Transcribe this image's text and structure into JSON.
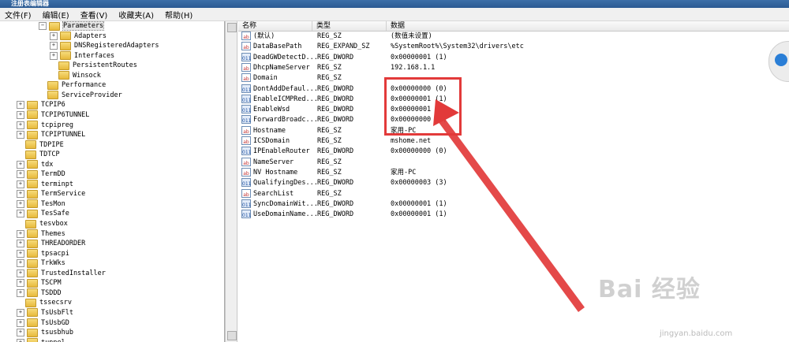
{
  "title_bar": {
    "title": "注册表编辑器"
  },
  "menu": [
    "文件(F)",
    "编辑(E)",
    "查看(V)",
    "收藏夹(A)",
    "帮助(H)"
  ],
  "tree": [
    {
      "label": "Parameters",
      "indent": 4,
      "expander": "minus",
      "selected": true
    },
    {
      "label": "Adapters",
      "indent": 5,
      "expander": "plus"
    },
    {
      "label": "DNSRegisteredAdapters",
      "indent": 5,
      "expander": "plus"
    },
    {
      "label": "Interfaces",
      "indent": 5,
      "expander": "plus"
    },
    {
      "label": "PersistentRoutes",
      "indent": 5,
      "expander": "none"
    },
    {
      "label": "Winsock",
      "indent": 5,
      "expander": "none"
    },
    {
      "label": "Performance",
      "indent": 4,
      "expander": "none"
    },
    {
      "label": "ServiceProvider",
      "indent": 4,
      "expander": "none"
    },
    {
      "label": "TCPIP6",
      "indent": 2,
      "expander": "plus"
    },
    {
      "label": "TCPIP6TUNNEL",
      "indent": 2,
      "expander": "plus"
    },
    {
      "label": "tcpipreg",
      "indent": 2,
      "expander": "plus"
    },
    {
      "label": "TCPIPTUNNEL",
      "indent": 2,
      "expander": "plus"
    },
    {
      "label": "TDPIPE",
      "indent": 2,
      "expander": "none"
    },
    {
      "label": "TDTCP",
      "indent": 2,
      "expander": "none"
    },
    {
      "label": "tdx",
      "indent": 2,
      "expander": "plus"
    },
    {
      "label": "TermDD",
      "indent": 2,
      "expander": "plus"
    },
    {
      "label": "terminpt",
      "indent": 2,
      "expander": "plus"
    },
    {
      "label": "TermService",
      "indent": 2,
      "expander": "plus"
    },
    {
      "label": "TesMon",
      "indent": 2,
      "expander": "plus"
    },
    {
      "label": "TesSafe",
      "indent": 2,
      "expander": "plus"
    },
    {
      "label": "tesvbox",
      "indent": 2,
      "expander": "none"
    },
    {
      "label": "Themes",
      "indent": 2,
      "expander": "plus"
    },
    {
      "label": "THREADORDER",
      "indent": 2,
      "expander": "plus"
    },
    {
      "label": "tpsacpi",
      "indent": 2,
      "expander": "plus"
    },
    {
      "label": "TrkWks",
      "indent": 2,
      "expander": "plus"
    },
    {
      "label": "TrustedInstaller",
      "indent": 2,
      "expander": "plus"
    },
    {
      "label": "TSCPM",
      "indent": 2,
      "expander": "plus"
    },
    {
      "label": "TSDDD",
      "indent": 2,
      "expander": "plus"
    },
    {
      "label": "tssecsrv",
      "indent": 2,
      "expander": "none"
    },
    {
      "label": "TsUsbFlt",
      "indent": 2,
      "expander": "plus"
    },
    {
      "label": "TsUsbGD",
      "indent": 2,
      "expander": "plus"
    },
    {
      "label": "tsusbhub",
      "indent": 2,
      "expander": "plus"
    },
    {
      "label": "tunnel",
      "indent": 2,
      "expander": "plus"
    }
  ],
  "list": {
    "headers": [
      "名称",
      "类型",
      "数据"
    ],
    "rows": [
      {
        "name": "(默认)",
        "type": "REG_SZ",
        "data": "(数值未设置)",
        "icon": "ab"
      },
      {
        "name": "DataBasePath",
        "type": "REG_EXPAND_SZ",
        "data": "%SystemRoot%\\System32\\drivers\\etc",
        "icon": "ab"
      },
      {
        "name": "DeadGWDetectD...",
        "type": "REG_DWORD",
        "data": "0x00000001 (1)",
        "icon": "dword"
      },
      {
        "name": "DhcpNameServer",
        "type": "REG_SZ",
        "data": "192.168.1.1",
        "icon": "ab"
      },
      {
        "name": "Domain",
        "type": "REG_SZ",
        "data": "",
        "icon": "ab"
      },
      {
        "name": "DontAddDefaul...",
        "type": "REG_DWORD",
        "data": "0x00000000 (0)",
        "icon": "dword"
      },
      {
        "name": "EnableICMPRed...",
        "type": "REG_DWORD",
        "data": "0x00000001 (1)",
        "icon": "dword"
      },
      {
        "name": "EnableWsd",
        "type": "REG_DWORD",
        "data": "0x00000001 (1)",
        "icon": "dword"
      },
      {
        "name": "ForwardBroadc...",
        "type": "REG_DWORD",
        "data": "0x00000000 (0)",
        "icon": "dword"
      },
      {
        "name": "Hostname",
        "type": "REG_SZ",
        "data": "家用-PC",
        "icon": "ab"
      },
      {
        "name": "ICSDomain",
        "type": "REG_SZ",
        "data": "mshome.net",
        "icon": "ab"
      },
      {
        "name": "IPEnableRouter",
        "type": "REG_DWORD",
        "data": "0x00000000 (0)",
        "icon": "dword"
      },
      {
        "name": "NameServer",
        "type": "REG_SZ",
        "data": "",
        "icon": "ab"
      },
      {
        "name": "NV Hostname",
        "type": "REG_SZ",
        "data": "家用-PC",
        "icon": "ab"
      },
      {
        "name": "QualifyingDes...",
        "type": "REG_DWORD",
        "data": "0x00000003 (3)",
        "icon": "dword"
      },
      {
        "name": "SearchList",
        "type": "REG_SZ",
        "data": "",
        "icon": "ab"
      },
      {
        "name": "SyncDomainWit...",
        "type": "REG_DWORD",
        "data": "0x00000001 (1)",
        "icon": "dword"
      },
      {
        "name": "UseDomainName...",
        "type": "REG_DWORD",
        "data": "0x00000001 (1)",
        "icon": "dword"
      }
    ]
  },
  "watermark": {
    "logo": "Bai 经验",
    "url": "jingyan.baidu.com"
  }
}
